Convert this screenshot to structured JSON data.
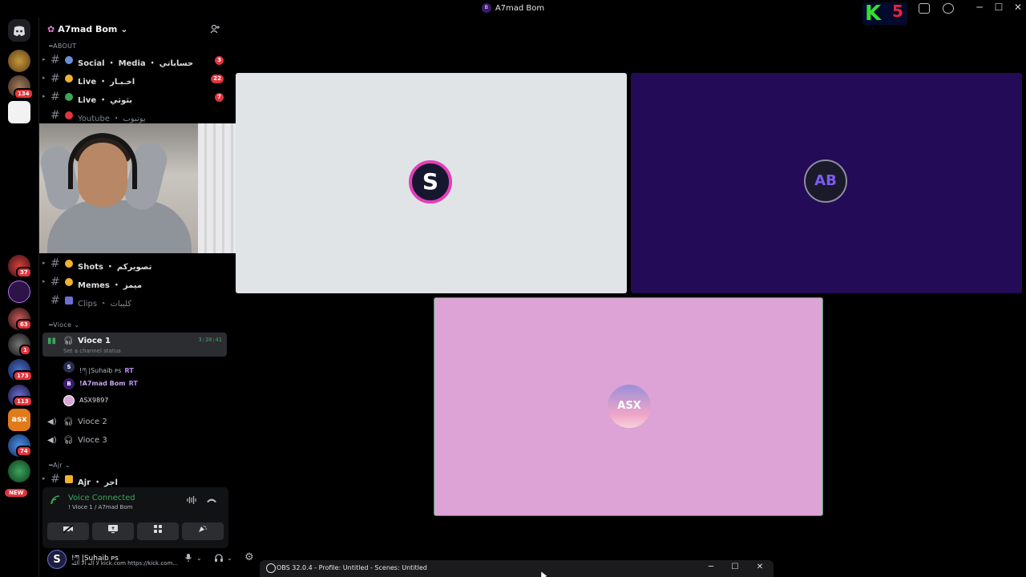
{
  "window": {
    "title": "A7mad Bom",
    "title_badge": "B"
  },
  "streamer_logo": {
    "letter": "K",
    "number": "5"
  },
  "server": {
    "name": "A7mad Bom"
  },
  "rail_badges": {
    "b1": "134",
    "b2": "37",
    "b3": "63",
    "b4": "1",
    "b5": "173",
    "b6": "113",
    "b7": "74",
    "new": "NEW"
  },
  "categories": {
    "about": "ABOUT",
    "vioce": "Vioce",
    "ajr": "Ajr"
  },
  "channels_top": [
    {
      "name": "Social ・ Media ・ حساباتي",
      "count": "3",
      "color": "#6b8fd6"
    },
    {
      "name": "Live ・ اخـبـار",
      "count": "22",
      "color": "#f0b232"
    },
    {
      "name": "Live ・ بثوثي",
      "count": "7",
      "color": "#3ba55c"
    },
    {
      "name": "Youtube ・ يوتيوب",
      "count": "",
      "color": "#e0353d"
    }
  ],
  "channels_mid": [
    {
      "name": "Shots ・ تصويركم",
      "color": "#f0b232"
    },
    {
      "name": "Memes ・ ميمز",
      "color": "#f0b232"
    },
    {
      "name": "Clips ・ كليبات",
      "color": "#6b6fd6"
    }
  ],
  "voice_active": {
    "name": "Vioce 1",
    "time": "3:30:41",
    "status": "Set a channel status"
  },
  "voice_members": [
    {
      "avatar": "S",
      "name": "!ཀ |Suhaib ᴘs",
      "tag": "RT",
      "color": "#2a2d55"
    },
    {
      "avatar": "B",
      "name": "!A7mad Bom",
      "tag": "RT",
      "color": "#3b1a6e"
    },
    {
      "avatar": "",
      "name": "ASX9897",
      "tag": "",
      "color": "#d8a8d6"
    }
  ],
  "voice_others": [
    {
      "name": "Vioce 2"
    },
    {
      "name": "Vioce 3"
    }
  ],
  "ajr_channel": {
    "name": "Ajr ・ اجر"
  },
  "voice_panel": {
    "title": "Voice Connected",
    "sub": "! Vioce 1 / A7mad Bom"
  },
  "user": {
    "avatar": "S",
    "name": "!ཀ |Suhaib ᴘs",
    "status": "لا اله الا الله kick.com https://kick.com..."
  },
  "tiles": {
    "t1": {
      "avatar": "S",
      "bg": "#e1e4e6"
    },
    "t2": {
      "avatar": "AB",
      "bg": "#240b57"
    },
    "t3": {
      "avatar": "ASX",
      "bg": "#dea3d6"
    }
  },
  "obs": {
    "title": "OBS 32.0.4 - Profile: Untitled - Scenes: Untitled"
  },
  "icons": {
    "min": "─",
    "max": "☐",
    "close": "✕",
    "discord": "discord-icon",
    "add_member": "add-member-icon"
  }
}
